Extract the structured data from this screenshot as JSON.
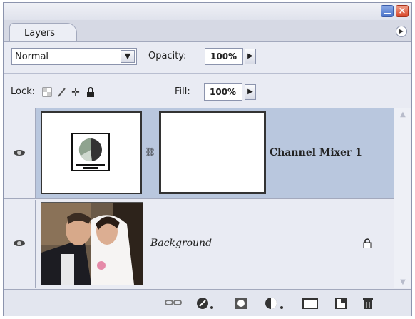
{
  "panel": {
    "tab_label": "Layers"
  },
  "blend_mode": {
    "value": "Normal"
  },
  "opacity": {
    "label": "Opacity:",
    "value": "100%"
  },
  "lock": {
    "label": "Lock:"
  },
  "fill": {
    "label": "Fill:",
    "value": "100%"
  },
  "layers": [
    {
      "name": "Channel Mixer 1",
      "selected": true,
      "visible": true
    },
    {
      "name": "Background",
      "selected": false,
      "visible": true,
      "locked": true
    }
  ],
  "bottom_icons": [
    "link-layers-icon",
    "layer-style-icon",
    "add-mask-icon",
    "adjustment-layer-icon",
    "new-group-icon",
    "new-layer-icon",
    "delete-layer-icon"
  ],
  "colors": {
    "selected_row": "#b9c7de",
    "panel_bg": "#e9ebf3"
  }
}
